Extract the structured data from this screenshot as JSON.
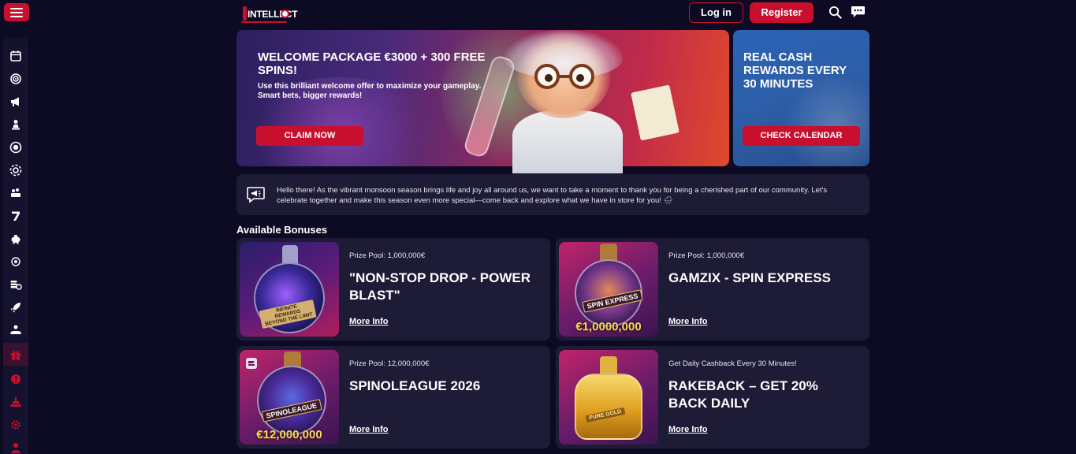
{
  "header": {
    "logo_text": "INTELLECT",
    "login_label": "Log in",
    "register_label": "Register",
    "icons": [
      "menu-icon",
      "search-icon",
      "chat-icon"
    ],
    "accent_color": "#c8102e"
  },
  "sidebar": {
    "items": [
      {
        "icon": "calendar-icon"
      },
      {
        "icon": "target-icon"
      },
      {
        "icon": "megaphone-icon"
      },
      {
        "icon": "chess-pawn-icon"
      },
      {
        "icon": "chip-icon"
      },
      {
        "icon": "poker-chip-icon"
      },
      {
        "icon": "lottery-icon"
      },
      {
        "icon": "seven-icon"
      },
      {
        "icon": "piggy-bank-icon"
      },
      {
        "icon": "wheel-icon"
      },
      {
        "icon": "coins-icon"
      },
      {
        "icon": "rocket-icon"
      },
      {
        "icon": "hand-coins-icon"
      },
      {
        "icon": "gift-icon",
        "active": true
      },
      {
        "icon": "live-icon"
      },
      {
        "icon": "trophy-icon"
      },
      {
        "icon": "settings-icon"
      },
      {
        "icon": "user-icon"
      }
    ]
  },
  "banners": {
    "main": {
      "title": "WELCOME PACKAGE €3000 + 300 FREE SPINS!",
      "description": "Use this brilliant welcome offer to maximize your gameplay. Smart bets, bigger rewards!",
      "button": "CLAIM NOW"
    },
    "side": {
      "title": "REAL CASH REWARDS EVERY 30 MINUTES",
      "button": "CHECK CALENDAR"
    }
  },
  "notice": {
    "text": "Hello there! As the vibrant monsoon season brings life and joy all around us, we want to take a moment to thank you for being a cherished part of our community. Let's celebrate together and make this season even more special—come back and explore what we have in store for you! 🌧"
  },
  "bonuses": {
    "section_title": "Available Bonuses",
    "items": [
      {
        "subtitle": "Prize Pool: 1,000,000€",
        "title": "\"NON-STOP DROP - POWER BLAST\"",
        "more": "More Info",
        "thumb_label": "INFINITE REWARDS BEYOND THE LIMIT",
        "thumb_amount": ""
      },
      {
        "subtitle": "Prize Pool: 1,000,000€",
        "title": "GAMZIX - SPIN EXPRESS",
        "more": "More Info",
        "thumb_label": "SPIN EXPRESS",
        "thumb_amount": "€1,0000,000"
      },
      {
        "subtitle": "Prize Pool: 12,000,000€",
        "title": "SPINOLEAGUE 2026",
        "more": "More Info",
        "thumb_label": "SPINOLEAGUE",
        "thumb_amount": "€12,000,000"
      },
      {
        "subtitle": "Get Daily Cashback Every 30 Minutes!",
        "title": "RAKEBACK – GET 20% BACK DAILY",
        "more": "More Info",
        "thumb_label": "PURE GOLD",
        "thumb_amount": ""
      }
    ]
  }
}
